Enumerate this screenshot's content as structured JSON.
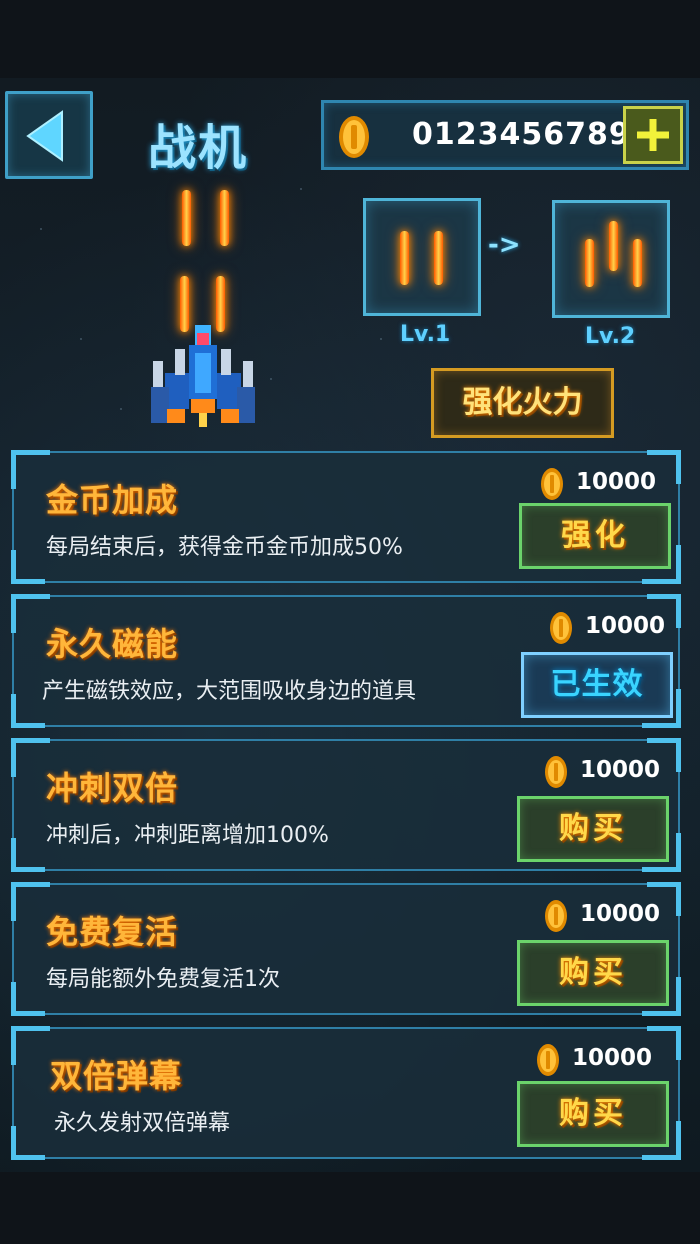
{
  "header": {
    "title": "战机",
    "coins": "0123456789"
  },
  "icons": {
    "back": "back-arrow-icon",
    "coin": "coin-icon",
    "add": "plus-icon",
    "fighter": "fighter-jet-icon"
  },
  "colors": {
    "accent_blue": "#4fc2ee",
    "gold": "#ffb63a",
    "green_button": "#6bd36b"
  },
  "weapon": {
    "current_level": "Lv.1",
    "arrow": "->",
    "next_level": "Lv.2",
    "upgrade_label": "强化火力"
  },
  "perks": [
    {
      "title": "金币加成",
      "desc": "每局结束后，获得金币金币加成50%",
      "price": "10000",
      "action": "强化",
      "state": "upgrade"
    },
    {
      "title": "永久磁能",
      "desc": "产生磁铁效应，大范围吸收身边的道具",
      "price": "10000",
      "action": "已生效",
      "state": "active"
    },
    {
      "title": "冲刺双倍",
      "desc": "冲刺后，冲刺距离增加100%",
      "price": "10000",
      "action": "购买",
      "state": "buy"
    },
    {
      "title": "免费复活",
      "desc": "每局能额外免费复活1次",
      "price": "10000",
      "action": "购买",
      "state": "buy"
    },
    {
      "title": "双倍弹幕",
      "desc": "永久发射双倍弹幕",
      "price": "10000",
      "action": "购买",
      "state": "buy"
    }
  ]
}
